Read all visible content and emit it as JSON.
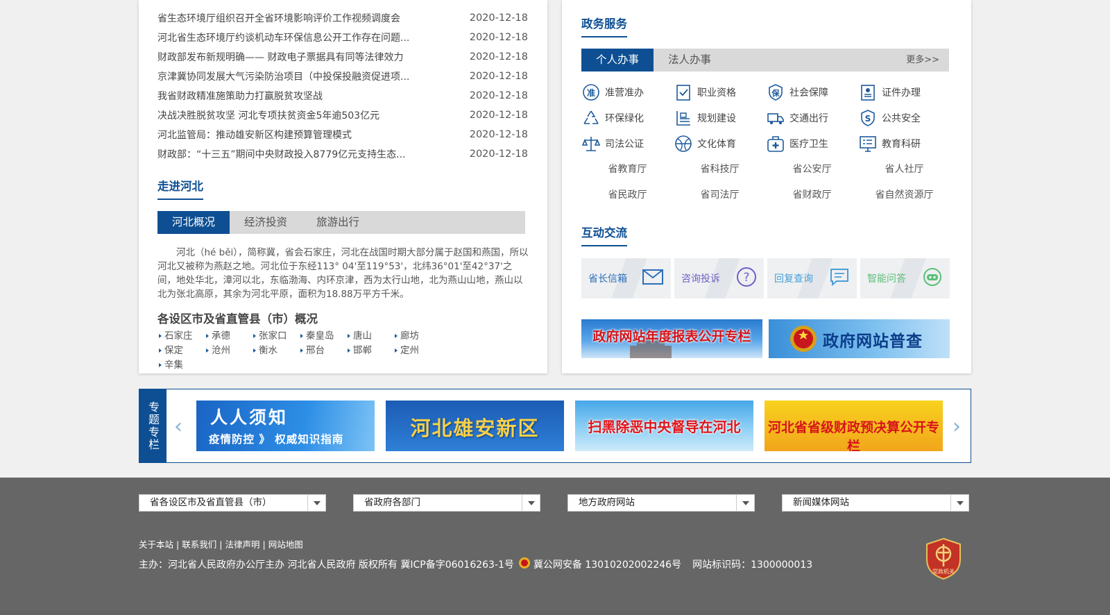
{
  "news": [
    {
      "title": "省生态环境厅组织召开全省环境影响评价工作视频调度会",
      "date": "2020-12-18"
    },
    {
      "title": "河北省生态环境厅约谈机动车环保信息公开工作存在问题...",
      "date": "2020-12-18"
    },
    {
      "title": "财政部发布新规明确—— 财政电子票据具有同等法律效力",
      "date": "2020-12-18"
    },
    {
      "title": "京津冀协同发展大气污染防治项目（中投保投融资促进项...",
      "date": "2020-12-18"
    },
    {
      "title": "我省财政精准施策助力打赢脱贫攻坚战",
      "date": "2020-12-18"
    },
    {
      "title": "决战决胜脱贫攻坚 河北专项扶贫资金5年逾503亿元",
      "date": "2020-12-18"
    },
    {
      "title": "河北监管局：推动雄安新区构建预算管理模式",
      "date": "2020-12-18"
    },
    {
      "title": "财政部：“十三五”期间中央财政投入8779亿元支持生态...",
      "date": "2020-12-18"
    }
  ],
  "hebei": {
    "title": "走进河北",
    "tabs": [
      "河北概况",
      "经济投资",
      "旅游出行"
    ],
    "intro": "河北（hé běi），简称冀，省会石家庄，河北在战国时期大部分属于赵国和燕国，所以河北又被称为燕赵之地。河北位于东经113° 04'至119°53'，北纬36°01'至42°37'之间，地处华北，漳河以北，东临渤海、内环京津，西为太行山地，北为燕山山地，燕山以北为张北高原，其余为河北平原，面积为18.88万平方千米。",
    "cities_title": "各设区市及省直管县（市）概况",
    "cities": [
      "石家庄",
      "承德",
      "张家口",
      "秦皇岛",
      "唐山",
      "廊坊",
      "保定",
      "沧州",
      "衡水",
      "邢台",
      "邯郸",
      "定州",
      "辛集"
    ]
  },
  "services": {
    "title": "政务服务",
    "tabs": [
      "个人办事",
      "法人办事"
    ],
    "more": "更多>>",
    "items": [
      {
        "label": "准营准办",
        "icon": "zhun-icon"
      },
      {
        "label": "职业资格",
        "icon": "checklist-icon"
      },
      {
        "label": "社会保障",
        "icon": "shield-bao-icon"
      },
      {
        "label": "证件办理",
        "icon": "id-card-icon"
      },
      {
        "label": "环保绿化",
        "icon": "recycle-icon"
      },
      {
        "label": "规划建设",
        "icon": "ruler-icon"
      },
      {
        "label": "交通出行",
        "icon": "truck-icon"
      },
      {
        "label": "公共安全",
        "icon": "shield-s-icon"
      },
      {
        "label": "司法公证",
        "icon": "scales-icon"
      },
      {
        "label": "文化体育",
        "icon": "ball-icon"
      },
      {
        "label": "医疗卫生",
        "icon": "medkit-icon"
      },
      {
        "label": "教育科研",
        "icon": "monitor-icon"
      }
    ],
    "depts": [
      "省教育厅",
      "省科技厅",
      "省公安厅",
      "省人社厅",
      "省民政厅",
      "省司法厅",
      "省财政厅",
      "省自然资源厅"
    ]
  },
  "interact": {
    "title": "互动交流",
    "items": [
      {
        "label": "省长信箱",
        "icon": "mail-icon",
        "color": "#2d6fb8"
      },
      {
        "label": "咨询投诉",
        "icon": "question-icon",
        "color": "#6f5fc7"
      },
      {
        "label": "回复查询",
        "icon": "chat-icon",
        "color": "#4a9ed8"
      },
      {
        "label": "智能问答",
        "icon": "robot-icon",
        "color": "#5cbf7a"
      }
    ]
  },
  "banners": {
    "report": "政府网站年度报表公开专栏",
    "check": "政府网站普查"
  },
  "special": {
    "label": "专题专栏",
    "b1_big": "人人须知",
    "b1_small": "疫情防控 》 权威知识指南",
    "b2": "河北雄安新区",
    "b3": "扫黑除恶中央督导在河北",
    "b4": "河北省省级财政预决算公开专栏"
  },
  "footer": {
    "selects": [
      "省各设区市及省直管县（市）",
      "省政府各部门",
      "地方政府网站",
      "新闻媒体网站"
    ],
    "links": [
      "关于本站",
      "联系我们",
      "法律声明",
      "网站地图"
    ],
    "host": "主办：河北省人民政府办公厅主办 河北省人民政府 版权所有 冀ICP备字06016263-1号",
    "police": "冀公网安备 13010202002246号",
    "site_id": "网站标识码：1300000013",
    "emblem": "党政机关"
  },
  "colors": {
    "brand": "#0e4f93",
    "footer": "#666666"
  }
}
